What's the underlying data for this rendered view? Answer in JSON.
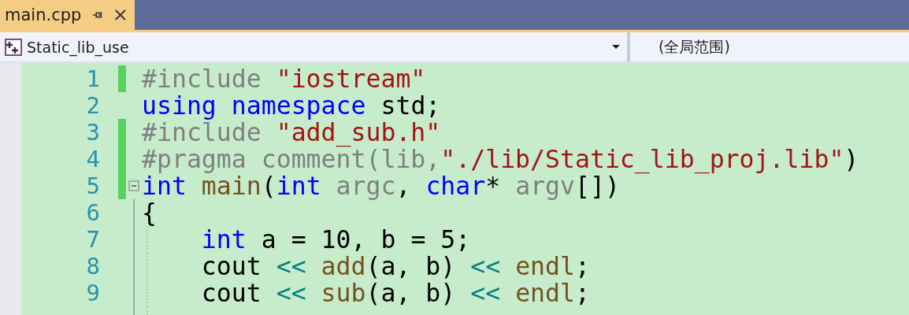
{
  "tab": {
    "title": "main.cpp",
    "selected": true
  },
  "navigation": {
    "project": "Static_lib_use",
    "scope": "(全局范围)"
  },
  "lines": [
    {
      "number": "1",
      "changed": true,
      "tokens": [
        {
          "kind": "preproc",
          "text": "#include "
        },
        {
          "kind": "string",
          "text": "\"iostream\""
        }
      ]
    },
    {
      "number": "2",
      "changed": false,
      "tokens": [
        {
          "kind": "keyword",
          "text": "using namespace"
        },
        {
          "kind": "plain",
          "text": " std;"
        }
      ]
    },
    {
      "number": "3",
      "changed": true,
      "tokens": [
        {
          "kind": "preproc",
          "text": "#include "
        },
        {
          "kind": "string",
          "text": "\"add_sub.h\""
        }
      ]
    },
    {
      "number": "4",
      "changed": true,
      "tokens": [
        {
          "kind": "preproc",
          "text": "#pragma comment(lib,"
        },
        {
          "kind": "string",
          "text": "\"./lib/Static_lib_proj.lib\""
        },
        {
          "kind": "plain",
          "text": ")"
        }
      ]
    },
    {
      "number": "5",
      "changed": true,
      "fold": {
        "expanded": true
      },
      "tokens": [
        {
          "kind": "keyword",
          "text": "int"
        },
        {
          "kind": "function",
          "text": " main"
        },
        {
          "kind": "plain",
          "text": "("
        },
        {
          "kind": "keyword",
          "text": "int"
        },
        {
          "kind": "param",
          "text": " argc"
        },
        {
          "kind": "plain",
          "text": ", "
        },
        {
          "kind": "keyword",
          "text": "char"
        },
        {
          "kind": "plain",
          "text": "* "
        },
        {
          "kind": "param",
          "text": "argv"
        },
        {
          "kind": "plain",
          "text": "[])"
        }
      ]
    },
    {
      "number": "6",
      "changed": false,
      "tokens": [
        {
          "kind": "plain",
          "text": "{"
        }
      ]
    },
    {
      "number": "7",
      "changed": false,
      "tokens": [
        {
          "kind": "keyword",
          "text": "    int"
        },
        {
          "kind": "plain",
          "text": " a = 10, b = 5;"
        }
      ]
    },
    {
      "number": "8",
      "changed": false,
      "tokens": [
        {
          "kind": "plain",
          "text": "    cout "
        },
        {
          "kind": "operator",
          "text": "<<"
        },
        {
          "kind": "function",
          "text": " add"
        },
        {
          "kind": "plain",
          "text": "(a, b) "
        },
        {
          "kind": "operator",
          "text": "<<"
        },
        {
          "kind": "function",
          "text": " endl"
        },
        {
          "kind": "plain",
          "text": ";"
        }
      ]
    },
    {
      "number": "9",
      "changed": false,
      "tokens": [
        {
          "kind": "plain",
          "text": "    cout "
        },
        {
          "kind": "operator",
          "text": "<<"
        },
        {
          "kind": "function",
          "text": " sub"
        },
        {
          "kind": "plain",
          "text": "(a, b) "
        },
        {
          "kind": "operator",
          "text": "<<"
        },
        {
          "kind": "function",
          "text": " endl"
        },
        {
          "kind": "plain",
          "text": ";"
        }
      ]
    }
  ]
}
